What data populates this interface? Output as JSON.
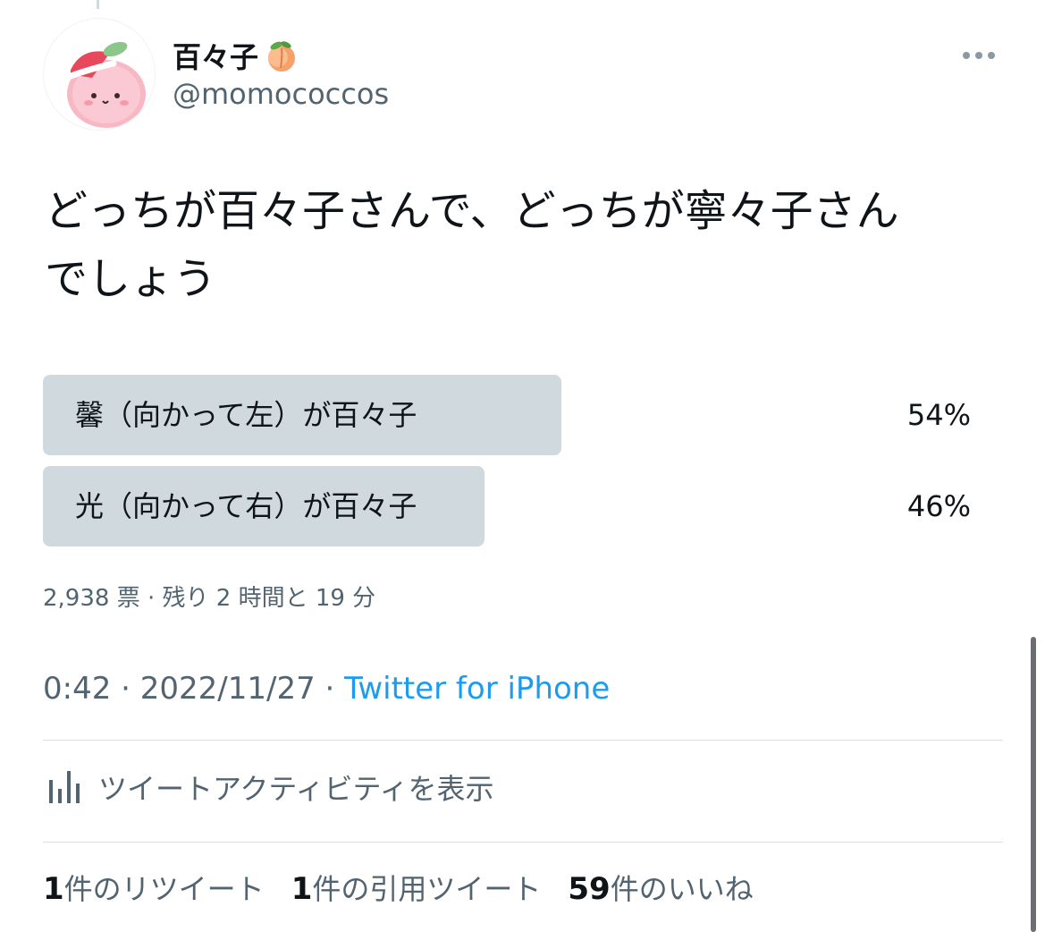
{
  "author": {
    "display_name": "百々子",
    "handle": "@momococcos",
    "name_emoji": "peach-icon",
    "avatar": "peach-character-avatar"
  },
  "tweet": {
    "text_line1": "どっちが百々子さんで、どっちが寧々子さん",
    "text_line2": "でしょう"
  },
  "poll": {
    "options": [
      {
        "label": "馨（向かって左）が百々子",
        "percent_text": "54%",
        "percent": 54
      },
      {
        "label": "光（向かって右）が百々子",
        "percent_text": "46%",
        "percent": 46
      }
    ],
    "meta": "2,938 票 · 残り 2 時間と 19 分",
    "bar_color": "#cfd9de"
  },
  "timestamp": {
    "time_date": "0:42 · 2022/11/27 · ",
    "source": "Twitter for iPhone"
  },
  "activity": {
    "label": "ツイートアクティビティを表示",
    "icon": "bar-chart-icon"
  },
  "stats": {
    "retweets_count": "1",
    "retweets_label": "件のリツイート",
    "quotes_count": "1",
    "quotes_label": "件の引用ツイート",
    "likes_count": "59",
    "likes_label": "件のいいね"
  },
  "colors": {
    "link": "#1d9bf0",
    "secondary_text": "#536471",
    "primary_text": "#0f1419"
  }
}
